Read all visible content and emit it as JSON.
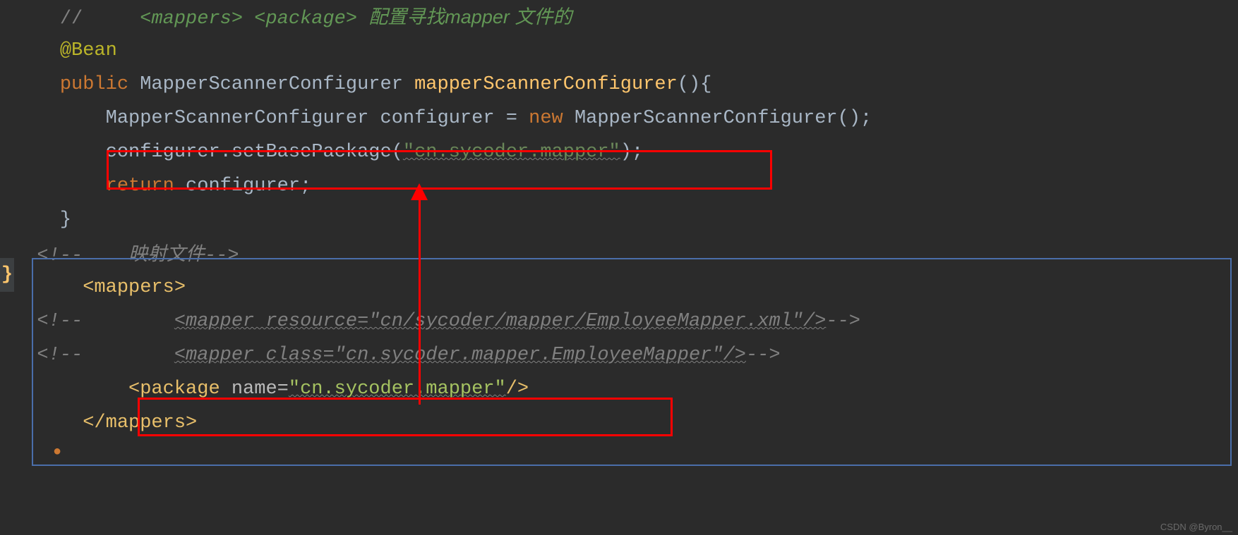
{
  "code": {
    "line1_slash": "//",
    "line1_xml1": "<mappers>",
    "line1_xml2": "<package>",
    "line1_cn": "配置寻找mapper 文件的",
    "line2_annotation": "@Bean",
    "line3_public": "public",
    "line3_type": "MapperScannerConfigurer",
    "line3_method": "mapperScannerConfigurer",
    "line3_parens": "(){",
    "line4_type": "MapperScannerConfigurer",
    "line4_var": "configurer",
    "line4_eq": " = ",
    "line4_new": "new",
    "line4_ctor": "MapperScannerConfigurer();",
    "line5_call": "configurer.setBasePackage(",
    "line5_str": "\"cn.sycoder.mapper\"",
    "line5_end": ");",
    "line6_return": "return",
    "line6_var": "configurer;",
    "line7_brace": "}",
    "line8_c1": "<!--",
    "line8_cn": "映射文件",
    "line8_c2": "-->",
    "line9_tag": "<mappers>",
    "line10_c1": "<!--",
    "line10_txt": "<mapper resource=\"cn/sycoder/mapper/EmployeeMapper.xml\"/>",
    "line10_c2": "-->",
    "line11_c1": "<!--",
    "line11_txt": "<mapper class=\"cn.sycoder.mapper.EmployeeMapper\"/>",
    "line11_c2": "-->",
    "line12_a": "<package",
    "line12_attr": "name",
    "line12_eq": "=",
    "line12_val": "\"cn.sycoder.mapper\"",
    "line12_end": "/>",
    "line13_tag": "</mappers>"
  },
  "gutter": {
    "marker": "}"
  },
  "watermark": "CSDN @Byron__"
}
